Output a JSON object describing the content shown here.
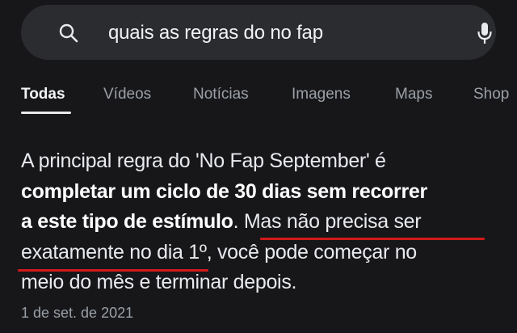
{
  "search": {
    "query": "quais as regras do no fap"
  },
  "tabs": [
    {
      "label": "Todas",
      "active": true
    },
    {
      "label": "Vídeos",
      "active": false
    },
    {
      "label": "Notícias",
      "active": false
    },
    {
      "label": "Imagens",
      "active": false
    },
    {
      "label": "Maps",
      "active": false
    },
    {
      "label": "Shop",
      "active": false
    }
  ],
  "snippet": {
    "line1": "A principal regra do 'No Fap September' é",
    "line2_bold": "completar um ciclo de 30 dias sem recorrer",
    "line3_bold": "a este tipo de estímulo",
    "line3_rest": ". Mas não precisa ser",
    "line4_underlined": "exatamente no dia",
    "line4_rest": " 1º, você pode começar no",
    "line5": "meio do mês e terminar depois.",
    "date": "1 de set. de 2021"
  },
  "colors": {
    "background": "#17171a",
    "search_bar": "#2b2c30",
    "highlight_underline": "#d11a1a"
  },
  "icons": {
    "search": "search-icon",
    "mic": "mic-icon"
  }
}
